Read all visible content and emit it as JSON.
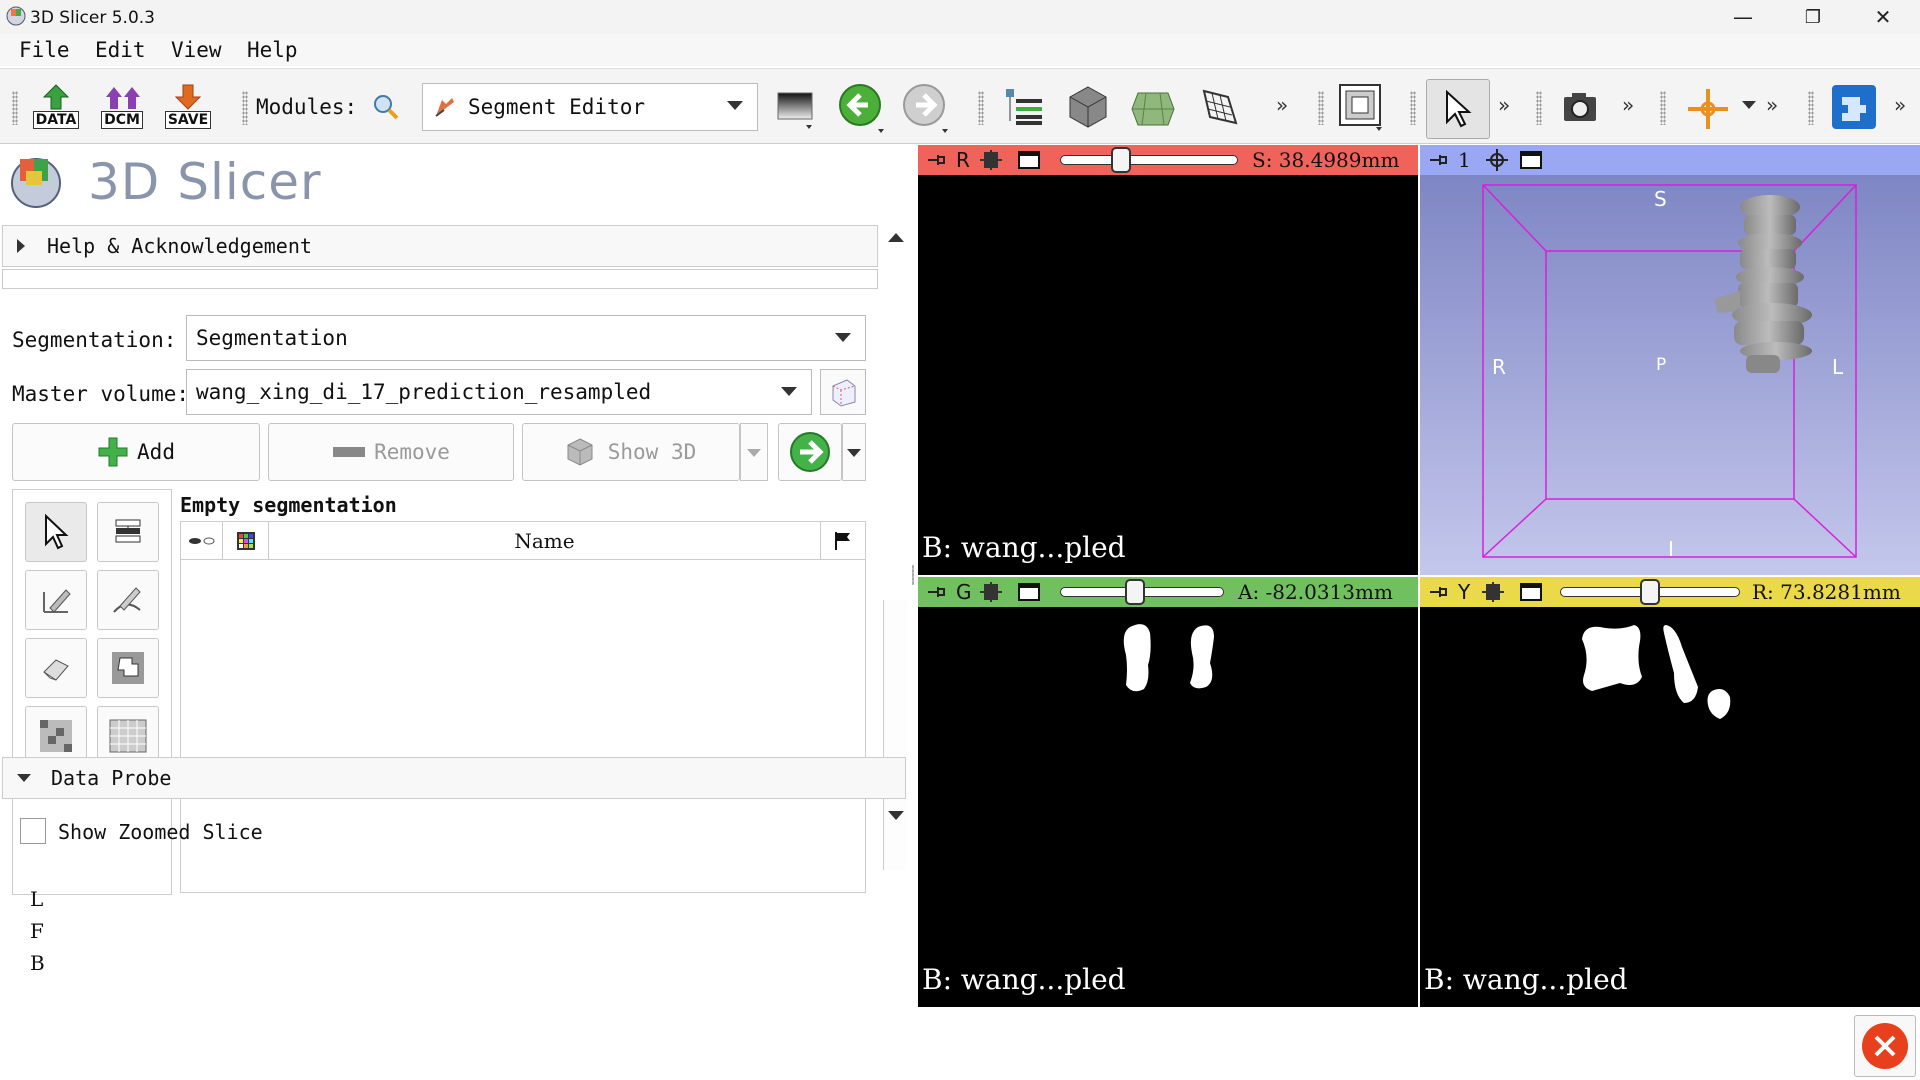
{
  "window": {
    "title": "3D Slicer 5.0.3",
    "minimize": "—",
    "maximize": "❐",
    "close": "✕"
  },
  "menu": [
    "File",
    "Edit",
    "View",
    "Help"
  ],
  "toolbar": {
    "data_label": "DATA",
    "dcm_label": "DCM",
    "save_label": "SAVE",
    "modules_label": "Modules:",
    "module_selected": "Segment Editor",
    "overflow": "»"
  },
  "logo": {
    "text": "3D Slicer"
  },
  "help_section": {
    "label": "Help & Acknowledgement"
  },
  "segment_editor": {
    "segmentation_label": "Segmentation:",
    "segmentation_value": "Segmentation",
    "master_volume_label": "Master volume:",
    "master_volume_value": "wang_xing_di_17_prediction_resampled",
    "add_label": "Add",
    "remove_label": "Remove",
    "show3d_label": "Show 3D",
    "empty_label": "Empty segmentation",
    "table_name_header": "Name"
  },
  "data_probe": {
    "label": "Data Probe",
    "show_zoomed_label": "Show Zoomed Slice",
    "lines": [
      "L",
      "F",
      "B"
    ]
  },
  "views": {
    "red": {
      "letter": "R",
      "offset": "S: 38.4989mm",
      "corner": "B: wang...pled",
      "color": "#f0635a",
      "slider_pos": 0.32
    },
    "threed": {
      "letter": "1",
      "color": "#9aa8f4",
      "labels": {
        "S": "S",
        "R": "R",
        "L": "L",
        "P": "P",
        "I": "I"
      }
    },
    "green": {
      "letter": "G",
      "offset": "A: -82.0313mm",
      "corner": "B: wang...pled",
      "color": "#70c060",
      "slider_pos": 0.45
    },
    "yellow": {
      "letter": "Y",
      "offset": "R: 73.8281mm",
      "corner": "B: wang...pled",
      "color": "#ead948",
      "slider_pos": 0.5
    }
  },
  "colors": {
    "accent_blue": "#3a7fd5",
    "red_close": "#e8401c"
  }
}
